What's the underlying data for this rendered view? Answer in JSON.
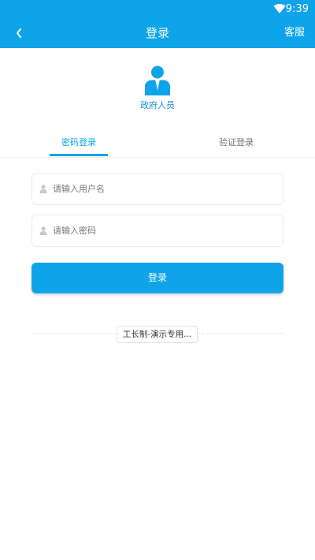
{
  "status_bar": {
    "time": "9:39",
    "wifi_icon": "wifi-icon"
  },
  "app_bar": {
    "title": "登录",
    "back_icon": "back-chevron-icon",
    "service_label": "客服"
  },
  "profile": {
    "avatar_icon": "person-avatar-icon",
    "role_label": "政府人员"
  },
  "tabs": [
    {
      "label": "密码登录",
      "active": true
    },
    {
      "label": "验证登录",
      "active": false
    }
  ],
  "form": {
    "username": {
      "placeholder": "请输入用户名",
      "value": "",
      "icon": "user-icon"
    },
    "password": {
      "placeholder": "请输入密码",
      "value": "",
      "icon": "user-icon"
    },
    "submit_label": "登录"
  },
  "org_selector": {
    "value": "工长制-演示专用..."
  },
  "colors": {
    "primary": "#0fa4ea",
    "role_text": "#1590d0",
    "muted_text": "#777777"
  }
}
